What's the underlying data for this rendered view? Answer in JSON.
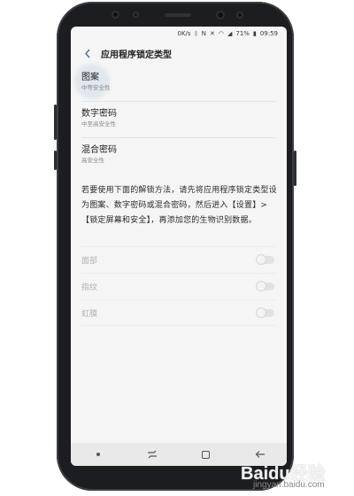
{
  "statusbar": {
    "speed": "0K/s",
    "battery": "71%",
    "time": "09:59",
    "icons": [
      "bluetooth-icon",
      "nfc-icon",
      "mute-icon",
      "wifi-icon",
      "signal-icon",
      "battery-icon"
    ]
  },
  "header": {
    "title": "应用程序锁定类型",
    "back_icon": "chevron-left-icon"
  },
  "lock_types": [
    {
      "title": "图案",
      "subtitle": "中等安全性"
    },
    {
      "title": "数字密码",
      "subtitle": "中至高安全性"
    },
    {
      "title": "混合密码",
      "subtitle": "高安全性"
    }
  ],
  "description": "若要使用下面的解锁方法，请先将应用程序锁定类型设为图案、数字密码或混合密码，然后进入【设置】>【锁定屏幕和安全】，再添加您的生物识别数据。",
  "biometrics": [
    {
      "label": "面部",
      "enabled": false
    },
    {
      "label": "指纹",
      "enabled": false
    },
    {
      "label": "虹膜",
      "enabled": false
    }
  ],
  "navbar": {
    "icons": [
      "notification-dot-icon",
      "recents-icon",
      "home-icon",
      "back-icon"
    ]
  },
  "watermark": {
    "line1": "Baidu经验",
    "line2": "jingyan.baidu.com"
  }
}
